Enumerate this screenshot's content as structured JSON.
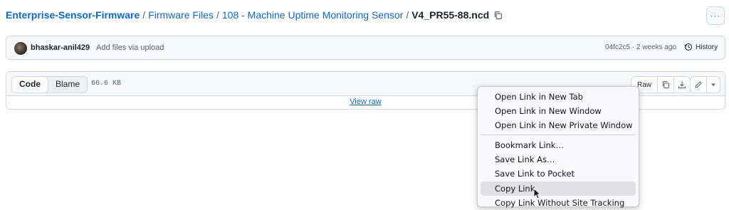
{
  "breadcrumb": {
    "repo": "Enterprise-Sensor-Firmware",
    "folder1": "Firmware Files",
    "folder2": "108 - Machine Uptime Monitoring Sensor",
    "file": "V4_PR55-88.ncd",
    "separator": "/"
  },
  "more_button": "···",
  "commit": {
    "author": "bhaskar-anil429",
    "message": "Add files via upload",
    "meta": "04fc2c5 · 2 weeks ago",
    "history_label": "History"
  },
  "file_header": {
    "code_tab": "Code",
    "blame_tab": "Blame",
    "size": "66.6 KB",
    "raw_label": "Raw"
  },
  "view_raw": "View raw",
  "context_menu": {
    "items": [
      "Open Link in New Tab",
      "Open Link in New Window",
      "Open Link in New Private Window",
      "Bookmark Link…",
      "Save Link As…",
      "Save Link to Pocket",
      "Copy Link",
      "Copy Link Without Site Tracking"
    ],
    "highlighted": "Copy Link"
  },
  "icons": [
    "copy-icon",
    "history-icon",
    "download-icon",
    "pencil-icon",
    "triangle-down-icon",
    "cursor-icon"
  ]
}
